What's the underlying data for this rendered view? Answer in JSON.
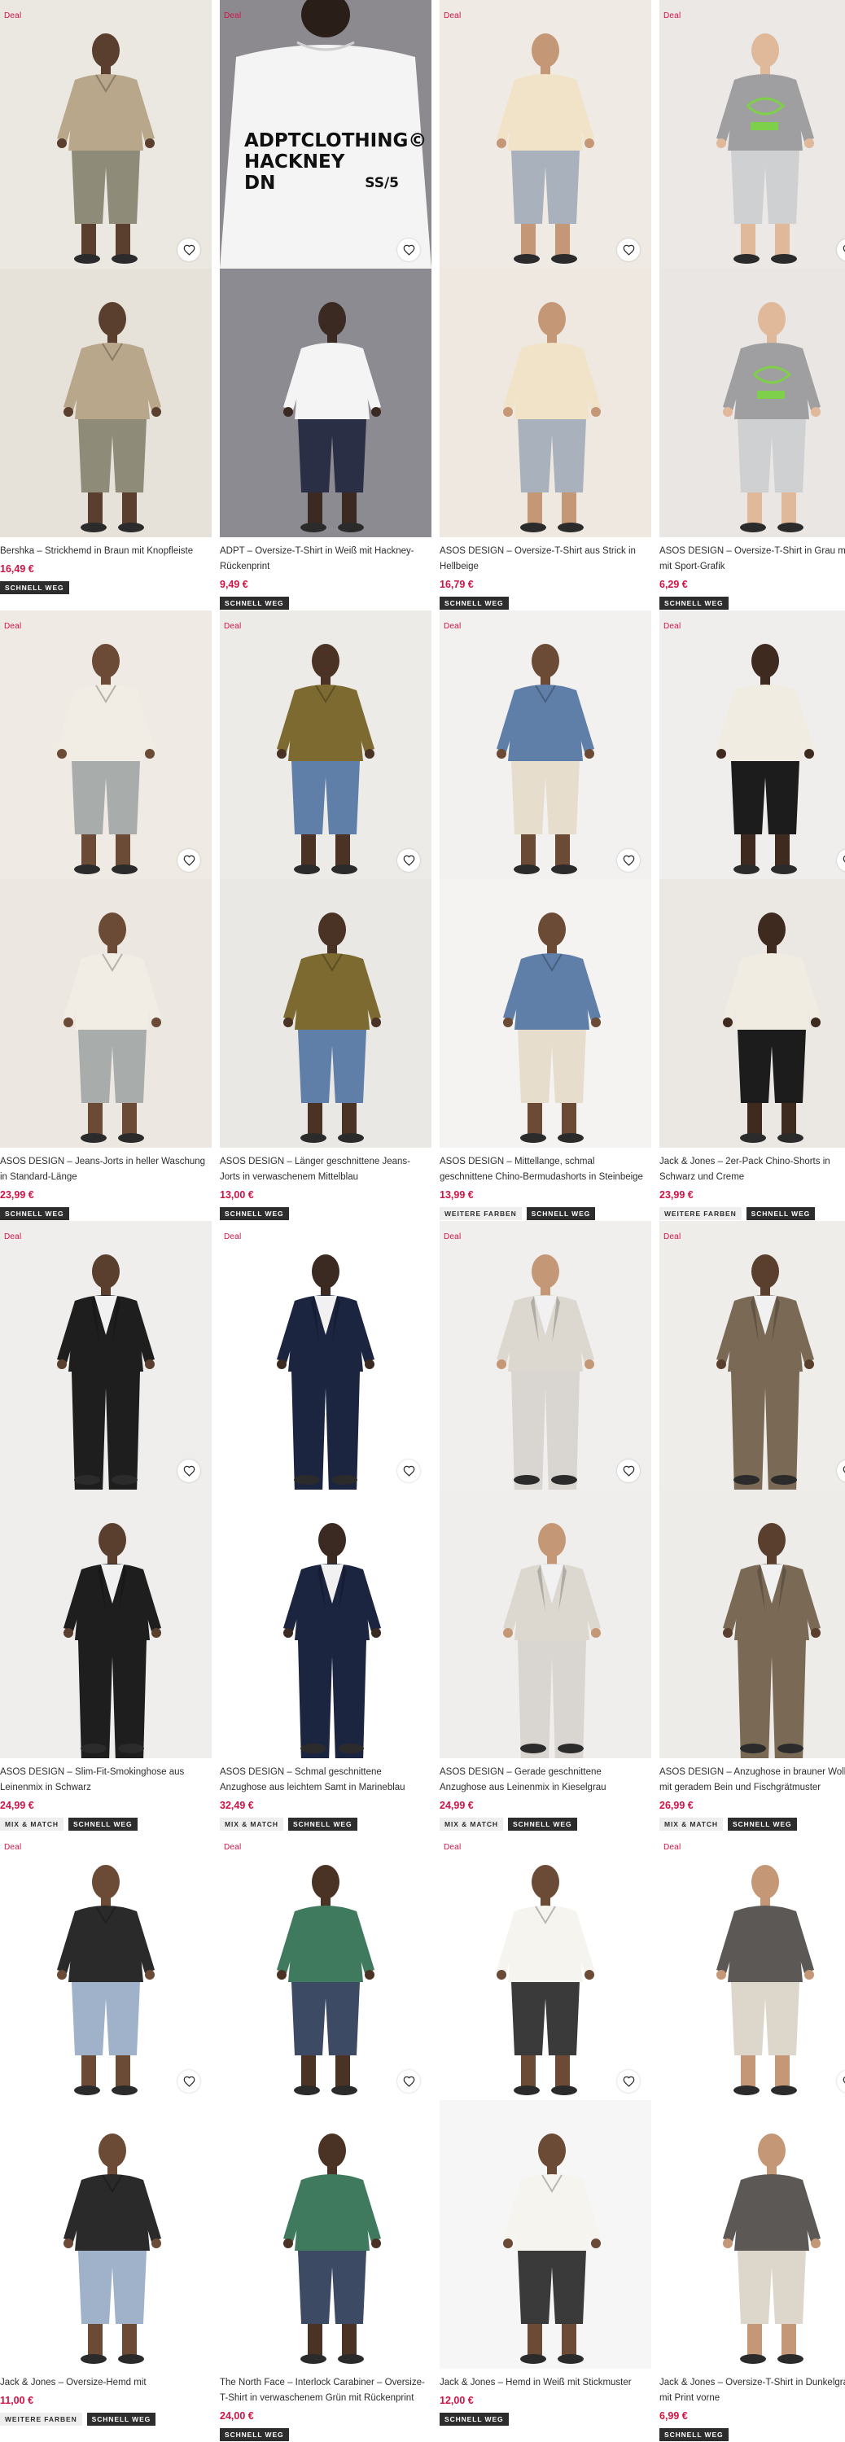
{
  "products": [
    {
      "deal": "Deal",
      "title": "Bershka – Strickhemd in Braun mit Knopfleiste",
      "price": "16,49 €",
      "badges": [
        "SCHNELL WEG"
      ]
    },
    {
      "deal": "Deal",
      "title": "ADPT – Oversize-T-Shirt in Weiß mit Hackney-Rückenprint",
      "price": "9,49 €",
      "badges": [
        "SCHNELL WEG"
      ],
      "print_text": [
        "ADPTCLOTHING©",
        "HACKNEY",
        "DN",
        "SS/5"
      ]
    },
    {
      "deal": "Deal",
      "title": "ASOS DESIGN – Oversize-T-Shirt aus Strick in Hellbeige",
      "price": "16,79 €",
      "badges": [
        "SCHNELL WEG"
      ]
    },
    {
      "deal": "Deal",
      "title": "ASOS DESIGN – Oversize-T-Shirt in Grau meliert mit Sport-Grafik",
      "price": "6,29 €",
      "badges": [
        "SCHNELL WEG"
      ]
    },
    {
      "deal": "Deal",
      "title": "ASOS DESIGN – Jeans-Jorts in heller Waschung in Standard-Länge",
      "price": "23,99 €",
      "badges": [
        "SCHNELL WEG"
      ]
    },
    {
      "deal": "Deal",
      "title": "ASOS DESIGN – Länger geschnittene Jeans-Jorts in verwaschenem Mittelblau",
      "price": "13,00 €",
      "badges": [
        "SCHNELL WEG"
      ]
    },
    {
      "deal": "Deal",
      "title": "ASOS DESIGN – Mittellange, schmal geschnittene Chino-Bermudashorts in Steinbeige",
      "price": "13,99 €",
      "badges": [
        "WEITERE FARBEN",
        "SCHNELL WEG"
      ]
    },
    {
      "deal": "Deal",
      "title": "Jack & Jones – 2er-Pack Chino-Shorts in Schwarz und Creme",
      "price": "23,99 €",
      "badges": [
        "WEITERE FARBEN",
        "SCHNELL WEG"
      ]
    },
    {
      "deal": "Deal",
      "title": "ASOS DESIGN – Slim-Fit-Smokinghose aus Leinenmix in Schwarz",
      "price": "24,99 €",
      "badges": [
        "MIX & MATCH",
        "SCHNELL WEG"
      ]
    },
    {
      "deal": "Deal",
      "title": "ASOS DESIGN – Schmal geschnittene Anzughose aus leichtem Samt in Marineblau",
      "price": "32,49 €",
      "badges": [
        "MIX & MATCH",
        "SCHNELL WEG"
      ]
    },
    {
      "deal": "Deal",
      "title": "ASOS DESIGN – Gerade geschnittene Anzughose aus Leinenmix in Kieselgrau",
      "price": "24,99 €",
      "badges": [
        "MIX & MATCH",
        "SCHNELL WEG"
      ]
    },
    {
      "deal": "Deal",
      "title": "ASOS DESIGN – Anzughose in brauner Wolloptik mit geradem Bein und Fischgrätmuster",
      "price": "26,99 €",
      "badges": [
        "MIX & MATCH",
        "SCHNELL WEG"
      ]
    },
    {
      "deal": "Deal",
      "title": "Jack & Jones – Oversize-Hemd mit Streifenmuster",
      "price": "11,00 €",
      "badges": [
        "WEITERE FARBEN",
        "SCHNELL WEG"
      ]
    },
    {
      "deal": "Deal",
      "title": "The North Face – Interlock Carabiner – Oversize-T-Shirt in verwaschenem Grün mit Rückenprint",
      "price": "24,00 €",
      "badges": [
        "SCHNELL WEG"
      ]
    },
    {
      "deal": "Deal",
      "title": "Jack & Jones – Hemd in Weiß mit Stickmuster",
      "price": "12,00 €",
      "badges": [
        "SCHNELL WEG"
      ]
    },
    {
      "deal": "Deal",
      "title": "Jack & Jones – Oversize-T-Shirt in Dunkelgrau mit Print vorne",
      "price": "6,99 €",
      "badges": [
        "SCHNELL WEG"
      ]
    }
  ],
  "colors": {
    "deal_red": "#d01345",
    "price_red": "#d01345",
    "badge_dark": "#2d2d2d",
    "badge_light": "#eeeeee",
    "text": "#2d2d2d"
  },
  "icons": {
    "heart": "heart-outline-icon"
  }
}
